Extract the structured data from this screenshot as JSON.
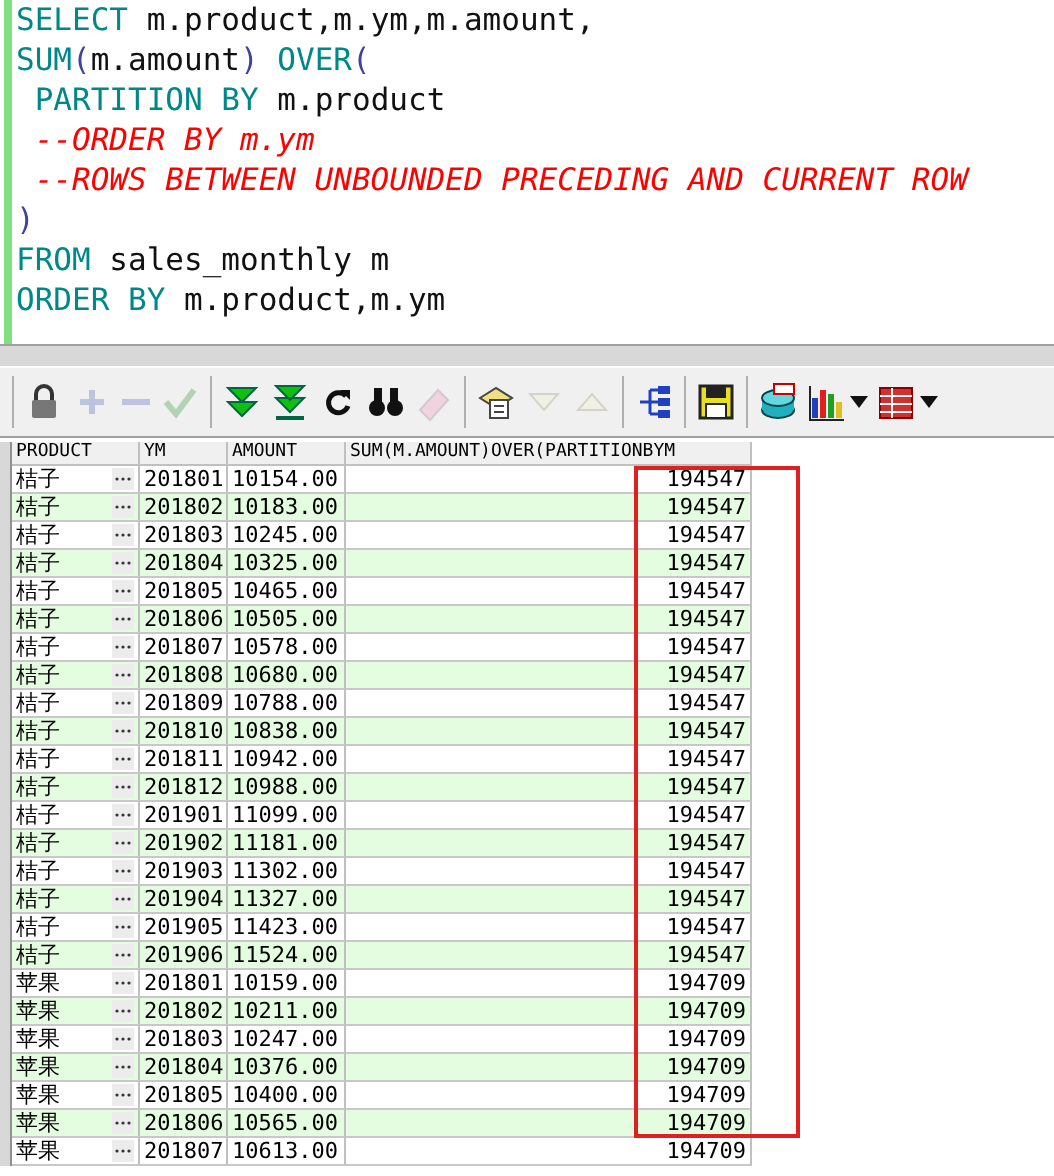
{
  "editor": {
    "lines": [
      {
        "tokens": [
          {
            "text": "SELECT",
            "kind": "keyword"
          },
          {
            "text": " m.product,m.ym,m.amount,",
            "kind": "plain"
          }
        ]
      },
      {
        "tokens": [
          {
            "text": "SUM",
            "kind": "keyword"
          },
          {
            "text": "(",
            "kind": "paren"
          },
          {
            "text": "m.amount",
            "kind": "plain"
          },
          {
            "text": ")",
            "kind": "paren"
          },
          {
            "text": " OVER",
            "kind": "keyword"
          },
          {
            "text": "(",
            "kind": "paren"
          }
        ]
      },
      {
        "tokens": [
          {
            "text": " PARTITION BY",
            "kind": "keyword"
          },
          {
            "text": " m.product",
            "kind": "plain"
          }
        ]
      },
      {
        "tokens": [
          {
            "text": " --ORDER BY m.ym",
            "kind": "comment"
          }
        ]
      },
      {
        "tokens": [
          {
            "text": " --ROWS BETWEEN UNBOUNDED PRECEDING AND CURRENT ROW",
            "kind": "comment"
          }
        ]
      },
      {
        "tokens": [
          {
            "text": ")",
            "kind": "paren"
          }
        ]
      },
      {
        "tokens": [
          {
            "text": "FROM",
            "kind": "keyword"
          },
          {
            "text": " sales_monthly m",
            "kind": "plain"
          }
        ]
      },
      {
        "tokens": [
          {
            "text": "ORDER BY",
            "kind": "keyword"
          },
          {
            "text": " m.product,m.ym",
            "kind": "plain"
          }
        ]
      }
    ]
  },
  "toolbar": {
    "groups": [
      [
        {
          "kind": "lock",
          "disabled": false
        },
        {
          "kind": "plus",
          "disabled": true
        },
        {
          "kind": "minus",
          "disabled": true
        },
        {
          "kind": "check",
          "disabled": true
        }
      ],
      [
        {
          "kind": "fetch-next",
          "disabled": false
        },
        {
          "kind": "fetch-last",
          "disabled": false
        },
        {
          "kind": "refresh",
          "disabled": false
        },
        {
          "kind": "find",
          "disabled": false
        },
        {
          "kind": "eraser",
          "disabled": true
        }
      ],
      [
        {
          "kind": "clipboard",
          "disabled": false
        },
        {
          "kind": "down",
          "disabled": true
        },
        {
          "kind": "up",
          "disabled": true
        }
      ],
      [
        {
          "kind": "tree",
          "disabled": false
        }
      ],
      [
        {
          "kind": "save",
          "disabled": false
        }
      ],
      [
        {
          "kind": "database",
          "disabled": false
        },
        {
          "kind": "chart",
          "disabled": false,
          "dropdown": true
        },
        {
          "kind": "table",
          "disabled": false,
          "dropdown": true
        }
      ]
    ]
  },
  "grid": {
    "columns": [
      "PRODUCT",
      "YM",
      "AMOUNT",
      "SUM(M.AMOUNT)OVER(PARTITIONBYM"
    ],
    "rows": [
      {
        "product": "桔子",
        "ym": "201801",
        "amount": "10154.00",
        "sum": "194547"
      },
      {
        "product": "桔子",
        "ym": "201802",
        "amount": "10183.00",
        "sum": "194547"
      },
      {
        "product": "桔子",
        "ym": "201803",
        "amount": "10245.00",
        "sum": "194547"
      },
      {
        "product": "桔子",
        "ym": "201804",
        "amount": "10325.00",
        "sum": "194547"
      },
      {
        "product": "桔子",
        "ym": "201805",
        "amount": "10465.00",
        "sum": "194547"
      },
      {
        "product": "桔子",
        "ym": "201806",
        "amount": "10505.00",
        "sum": "194547"
      },
      {
        "product": "桔子",
        "ym": "201807",
        "amount": "10578.00",
        "sum": "194547"
      },
      {
        "product": "桔子",
        "ym": "201808",
        "amount": "10680.00",
        "sum": "194547"
      },
      {
        "product": "桔子",
        "ym": "201809",
        "amount": "10788.00",
        "sum": "194547"
      },
      {
        "product": "桔子",
        "ym": "201810",
        "amount": "10838.00",
        "sum": "194547"
      },
      {
        "product": "桔子",
        "ym": "201811",
        "amount": "10942.00",
        "sum": "194547"
      },
      {
        "product": "桔子",
        "ym": "201812",
        "amount": "10988.00",
        "sum": "194547"
      },
      {
        "product": "桔子",
        "ym": "201901",
        "amount": "11099.00",
        "sum": "194547"
      },
      {
        "product": "桔子",
        "ym": "201902",
        "amount": "11181.00",
        "sum": "194547"
      },
      {
        "product": "桔子",
        "ym": "201903",
        "amount": "11302.00",
        "sum": "194547"
      },
      {
        "product": "桔子",
        "ym": "201904",
        "amount": "11327.00",
        "sum": "194547"
      },
      {
        "product": "桔子",
        "ym": "201905",
        "amount": "11423.00",
        "sum": "194547"
      },
      {
        "product": "桔子",
        "ym": "201906",
        "amount": "11524.00",
        "sum": "194547"
      },
      {
        "product": "苹果",
        "ym": "201801",
        "amount": "10159.00",
        "sum": "194709"
      },
      {
        "product": "苹果",
        "ym": "201802",
        "amount": "10211.00",
        "sum": "194709"
      },
      {
        "product": "苹果",
        "ym": "201803",
        "amount": "10247.00",
        "sum": "194709"
      },
      {
        "product": "苹果",
        "ym": "201804",
        "amount": "10376.00",
        "sum": "194709"
      },
      {
        "product": "苹果",
        "ym": "201805",
        "amount": "10400.00",
        "sum": "194709"
      },
      {
        "product": "苹果",
        "ym": "201806",
        "amount": "10565.00",
        "sum": "194709"
      },
      {
        "product": "苹果",
        "ym": "201807",
        "amount": "10613.00",
        "sum": "194709"
      }
    ]
  }
}
